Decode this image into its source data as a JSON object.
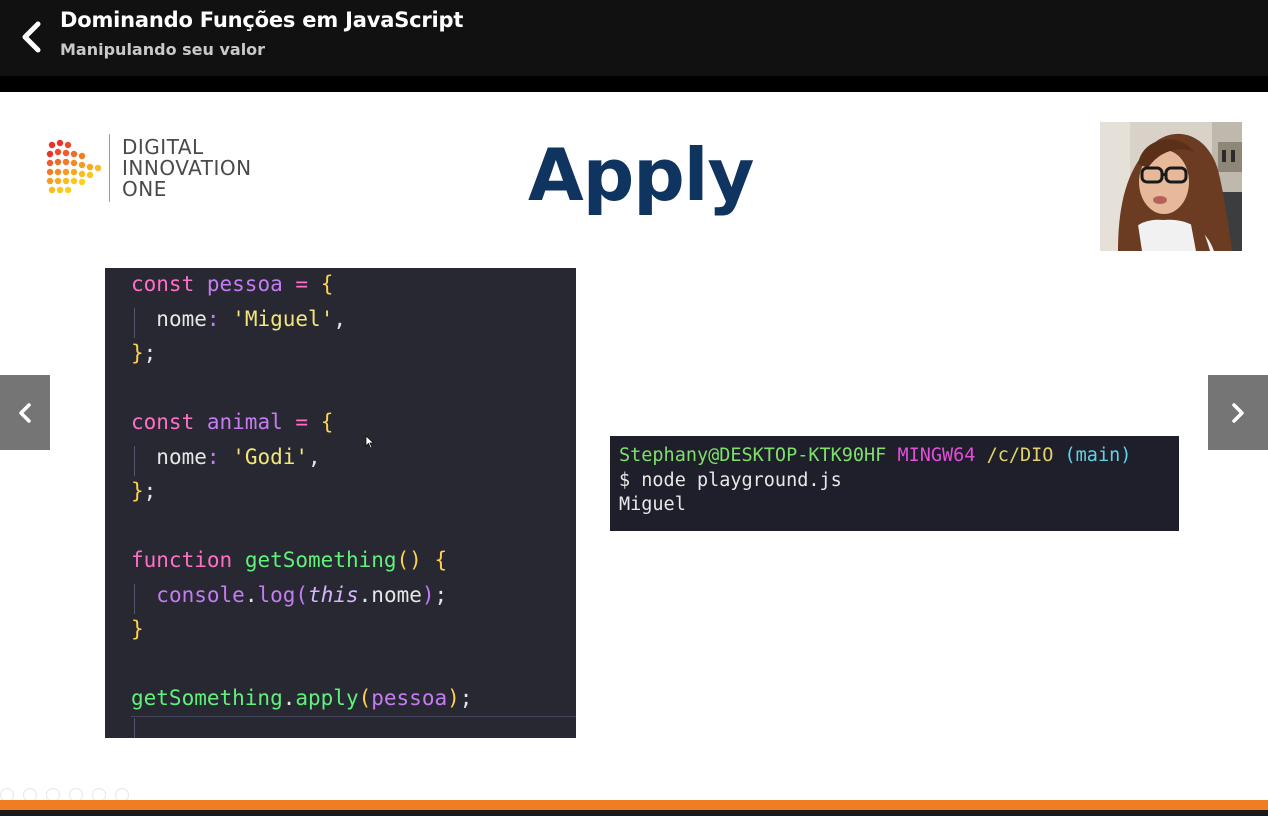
{
  "header": {
    "course_title": "Dominando Funções em JavaScript",
    "lesson_title": "Manipulando seu valor"
  },
  "slide": {
    "title": "Apply",
    "logo": {
      "line1": "DIGITAL",
      "line2": "INNOVATION",
      "line3": "ONE"
    },
    "code": {
      "l1_kw": "const",
      "l1_var": "pessoa",
      "l1_op": "=",
      "l1_brace": "{",
      "l2_key": "nome",
      "l2_colon": ":",
      "l2_str": "'Miguel'",
      "l2_comma": ",",
      "l3_brace": "}",
      "l3_semi": ";",
      "l5_kw": "const",
      "l5_var": "animal",
      "l5_op": "=",
      "l5_brace": "{",
      "l6_key": "nome",
      "l6_colon": ":",
      "l6_str": "'Godi'",
      "l6_comma": ",",
      "l7_brace": "}",
      "l7_semi": ";",
      "l9_kw": "function",
      "l9_fn": "getSomething",
      "l9_parens": "()",
      "l9_brace": "{",
      "l10_obj": "console",
      "l10_dot": ".",
      "l10_method": "log",
      "l10_paren_open": "(",
      "l10_this": "this",
      "l10_dot2": ".",
      "l10_prop": "nome",
      "l10_paren_close": ")",
      "l10_semi": ";",
      "l11_brace": "}",
      "l13_fn": "getSomething",
      "l13_dot": ".",
      "l13_method": "apply",
      "l13_paren_open": "(",
      "l13_arg": "pessoa",
      "l13_paren_close": ")",
      "l13_semi": ";"
    },
    "terminal": {
      "user": "Stephany@DESKTOP-KTK90HF",
      "shell": "MINGW64",
      "path": "/c/DIO",
      "branch": "(main)",
      "command": "$ node playground.js",
      "output": "Miguel"
    }
  },
  "colors": {
    "accent_orange": "#ef7d22",
    "title_navy": "#0f3460",
    "code_bg": "#282833"
  },
  "icons": {
    "back": "chevron-left-icon",
    "prev": "chevron-left-icon",
    "next": "chevron-right-icon"
  }
}
